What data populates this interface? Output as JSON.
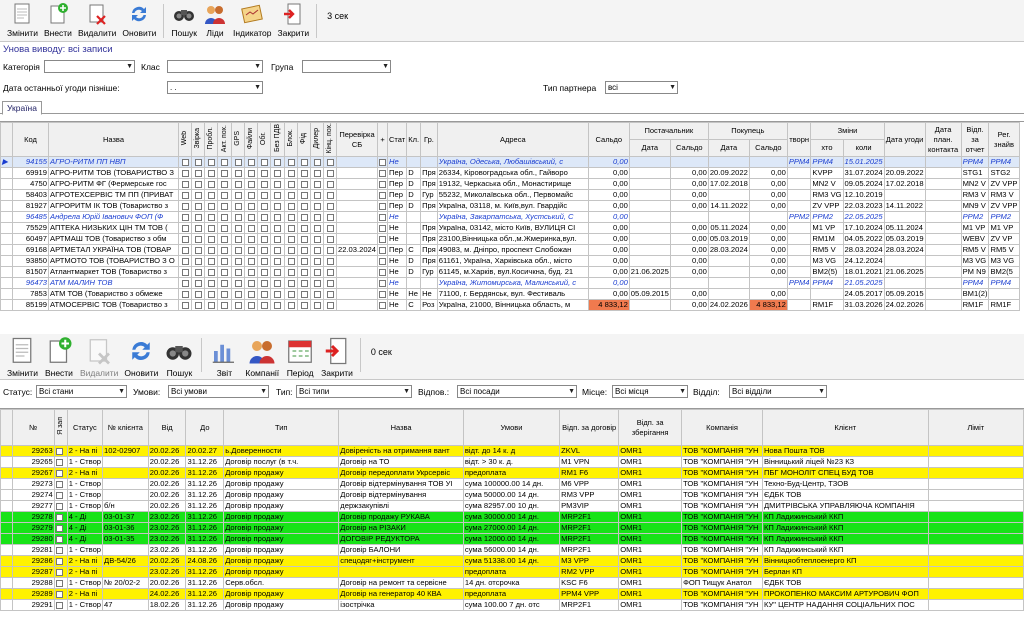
{
  "toolbar1": {
    "buttons": [
      {
        "label": "Змінити",
        "icon": "document-edit-icon"
      },
      {
        "label": "Внести",
        "icon": "document-add-icon"
      },
      {
        "label": "Видалити",
        "icon": "document-delete-icon"
      },
      {
        "label": "Оновити",
        "icon": "refresh-icon"
      },
      {
        "label": "Пошук",
        "icon": "binoculars-icon"
      },
      {
        "label": "Ліди",
        "icon": "people-icon"
      },
      {
        "label": "Індикатор",
        "icon": "indicator-icon"
      },
      {
        "label": "Закрити",
        "icon": "exit-door-icon"
      }
    ],
    "timer": "3 сек"
  },
  "title": "Унова виводу: всі записи",
  "filters1": {
    "category_label": "Категорія",
    "class_label": "Клас",
    "group_label": "Група",
    "date_label": "Дата останньої угоди пізніше:",
    "date_value": ". .",
    "partner_type_label": "Тип партнера",
    "partner_type_value": "всі"
  },
  "tab": "Україна",
  "grid1": {
    "headers": {
      "code": "Код",
      "name": "Назва",
      "web": "Web",
      "paid": "Звірка",
      "prob": "Пробл.",
      "akt": "Акт. пох.",
      "gps": "GPS",
      "files": "Файли",
      "obg": "Обг.",
      "bez": "Без ПДВ",
      "blk": "Блок.",
      "fid": "Фід",
      "dil": "Дилер",
      "kinc": "Кінц. пох.",
      "perev": "Перевірка СБ",
      "plus": "+",
      "stat": "Стат",
      "kl": "Кл.",
      "gr": "Гр.",
      "addr": "Адреса",
      "saldo": "Сальдо",
      "supplier": "Постачальник",
      "buyer": "Покупець",
      "date": "Дата",
      "sald": "Сальдо",
      "creat": "творн",
      "changes": "Зміни",
      "who": "хто",
      "when": "коли",
      "deal_date": "Дата угоди",
      "plan_date": "Дата план. контакта",
      "sent": "Відп. за отчет",
      "reg": "Рег. знайв"
    },
    "rows": [
      {
        "code": "94155",
        "name": "АГРО-РИТМ ПП НВП",
        "perev": "",
        "stat": "Не",
        "kl": "",
        "gr": "",
        "addr": "Україна, Одеська, Любашівський, с",
        "saldo": "0,00",
        "sd": "",
        "ss": "",
        "bd": "",
        "bs": "",
        "creat": "РРМ4",
        "who": "РРМ4",
        "when": "15.01.2025",
        "deal": "",
        "plan": "",
        "sent": "РРМ4",
        "reg": "РРМ4",
        "style": "blue sel"
      },
      {
        "code": "69919",
        "name": "АГРО-РИТМ ТОВ (ТОВАРИСТВО З",
        "perev": "",
        "stat": "Пер",
        "kl": "D",
        "gr": "Пря",
        "addr": "26334, Кіровоградська обл., Гайворо",
        "saldo": "0,00",
        "sd": "",
        "ss": "0,00",
        "bd": "20.09.2022",
        "bs": "0,00",
        "creat": "",
        "who": "KVPP",
        "when": "31.07.2024",
        "deal": "20.09.2022",
        "plan": "",
        "sent": "STG1",
        "reg": "STG2",
        "style": ""
      },
      {
        "code": "4750",
        "name": "АГРО-РИТМ ФГ (Фермерське гос",
        "perev": "",
        "stat": "Пер",
        "kl": "D",
        "gr": "Пря",
        "addr": "19132, Черкаська обл., Монастирище",
        "saldo": "0,00",
        "sd": "",
        "ss": "0,00",
        "bd": "17.02.2018",
        "bs": "0,00",
        "creat": "",
        "who": "MN2 V",
        "when": "09.05.2024",
        "deal": "17.02.2018",
        "plan": "",
        "sent": "MN2 V",
        "reg": "ZV VPP",
        "style": ""
      },
      {
        "code": "58403",
        "name": "АГРОТЕХСЕРВІС ТМ ПП (ПРИВАТ",
        "perev": "",
        "stat": "Пер",
        "kl": "D",
        "gr": "Гур",
        "addr": "55232, Миколаївська обл., Первомайс",
        "saldo": "0,00",
        "sd": "",
        "ss": "0,00",
        "bd": "",
        "bs": "0,00",
        "creat": "",
        "who": "RM3 VG",
        "when": "12.10.2019",
        "deal": "",
        "plan": "",
        "sent": "RM3 V",
        "reg": "RM3 V",
        "style": ""
      },
      {
        "code": "81927",
        "name": "АГРОРИТМ ІК ТОВ (Товариство з",
        "perev": "",
        "stat": "Пер",
        "kl": "D",
        "gr": "Пря",
        "addr": "Україна, 03118, м. Київ,вул. Гвардійс",
        "saldo": "0,00",
        "sd": "",
        "ss": "0,00",
        "bd": "14.11.2022",
        "bs": "0,00",
        "creat": "",
        "who": "ZV VPP",
        "when": "22.03.2023",
        "deal": "14.11.2022",
        "plan": "",
        "sent": "MN9 V",
        "reg": "ZV VPP",
        "style": ""
      },
      {
        "code": "96485",
        "name": "Андрела Юрій Іванович ФОП (Ф",
        "perev": "",
        "stat": "Не",
        "kl": "",
        "gr": "",
        "addr": "Україна, Закарпатська, Хустський, С",
        "saldo": "0,00",
        "sd": "",
        "ss": "",
        "bd": "",
        "bs": "",
        "creat": "РРМ2",
        "who": "РРМ2",
        "when": "22.05.2025",
        "deal": "",
        "plan": "",
        "sent": "РРМ2",
        "reg": "РРМ2",
        "style": "blue"
      },
      {
        "code": "75529",
        "name": "АПТЕКА НИЗЬКИХ ЦІН ТМ ТОВ (",
        "perev": "",
        "stat": "Не",
        "kl": "",
        "gr": "Пря",
        "addr": "Україна, 03142, місто Київ, ВУЛИЦЯ СІ",
        "saldo": "0,00",
        "sd": "",
        "ss": "0,00",
        "bd": "05.11.2024",
        "bs": "0,00",
        "creat": "",
        "who": "M1 VP",
        "when": "17.10.2024",
        "deal": "05.11.2024",
        "plan": "",
        "sent": "M1 VP",
        "reg": "M1 VP",
        "style": ""
      },
      {
        "code": "60497",
        "name": "АРТМАШ ТОВ (Товариство з обм",
        "perev": "",
        "stat": "Не",
        "kl": "",
        "gr": "Пря",
        "addr": "23100,Вінницька обл.,м.Жмеринка,вул.",
        "saldo": "0,00",
        "sd": "",
        "ss": "0,00",
        "bd": "05.03.2019",
        "bs": "0,00",
        "creat": "",
        "who": "RM1M",
        "when": "04.05.2022",
        "deal": "05.03.2019",
        "plan": "",
        "sent": "WEBV",
        "reg": "ZV VP",
        "style": ""
      },
      {
        "code": "69168",
        "name": "АРТМЕТАЛ УКРАЇНА ТОВ (ТОВАР",
        "perev": "22.03.2024",
        "stat": "Пер",
        "kl": "С",
        "gr": "Пря",
        "addr": "49083, м. Дніпро, проспект Слобожан",
        "saldo": "0,00",
        "sd": "",
        "ss": "0,00",
        "bd": "28.03.2024",
        "bs": "0,00",
        "creat": "",
        "who": "RM5 V",
        "when": "28.03.2024",
        "deal": "28.03.2024",
        "plan": "",
        "sent": "RM5 V",
        "reg": "RM5 V",
        "style": ""
      },
      {
        "code": "93850",
        "name": "АРТМОТО ТОВ (ТОВАРИСТВО З О",
        "perev": "",
        "stat": "Не",
        "kl": "D",
        "gr": "Пря",
        "addr": "61161, Україна, Харківська обл., місто",
        "saldo": "0,00",
        "sd": "",
        "ss": "0,00",
        "bd": "",
        "bs": "0,00",
        "creat": "",
        "who": "M3 VG",
        "when": "24.12.2024",
        "deal": "",
        "plan": "",
        "sent": "M3 VG",
        "reg": "M3 VG",
        "style": ""
      },
      {
        "code": "81507",
        "name": "Атлантмаркет ТОВ (Товариство з",
        "perev": "",
        "stat": "Не",
        "kl": "D",
        "gr": "Гур",
        "addr": "61145, м.Харків, вул.Косичкна, буд. 21",
        "saldo": "0,00",
        "sd": "21.06.2025",
        "ss": "0,00",
        "bd": "",
        "bs": "0,00",
        "creat": "",
        "who": "BM2(5)",
        "when": "18.01.2021",
        "deal": "21.06.2025",
        "plan": "",
        "sent": "PM N9",
        "reg": "BM2(5",
        "style": ""
      },
      {
        "code": "96473",
        "name": "АТМ МАЛИН ТОВ",
        "perev": "",
        "stat": "Не",
        "kl": "",
        "gr": "",
        "addr": "Україна, Житомирська, Малинський, с",
        "saldo": "0,00",
        "sd": "",
        "ss": "",
        "bd": "",
        "bs": "",
        "creat": "РРМ4",
        "who": "РРМ4",
        "when": "21.05.2025",
        "deal": "",
        "plan": "",
        "sent": "РРМ4",
        "reg": "РРМ4",
        "style": "blue"
      },
      {
        "code": "7853",
        "name": "АТМ ТОВ (Товариство з обмеже",
        "perev": "",
        "stat": "Не",
        "kl": "Не",
        "gr": "Не",
        "addr": "71100, г. Бердянськ, вул. Фестиваль",
        "saldo": "0,00",
        "sd": "05.09.2015",
        "ss": "0,00",
        "bd": "",
        "bs": "0,00",
        "creat": "",
        "who": "",
        "when": "24.05.2017",
        "deal": "05.09.2015",
        "plan": "",
        "sent": "BM1(2)",
        "reg": "",
        "style": ""
      },
      {
        "code": "85199",
        "name": "АТМОСЕРВІС ТОВ (Товариство з",
        "perev": "",
        "stat": "Не",
        "kl": "С",
        "gr": "Роз",
        "addr": "Україна, 21000, Вінницька область, м",
        "saldo": "4 833,12",
        "sd": "",
        "ss": "0,00",
        "bd": "24.02.2026",
        "bs": "4 833,12",
        "creat": "",
        "who": "RM1F",
        "when": "31.03.2026",
        "deal": "24.02.2026",
        "plan": "",
        "sent": "RM1F",
        "reg": "RM1F",
        "style": "",
        "red": true
      }
    ]
  },
  "toolbar2": {
    "buttons": [
      {
        "label": "Змінити",
        "icon": "document-edit-icon"
      },
      {
        "label": "Внести",
        "icon": "document-add-icon"
      },
      {
        "label": "Видалити",
        "icon": "document-delete-icon"
      },
      {
        "label": "Оновити",
        "icon": "refresh-icon"
      },
      {
        "label": "Пошук",
        "icon": "binoculars-icon"
      },
      {
        "label": "Звіт",
        "icon": "report-chart-icon"
      },
      {
        "label": "Компанії",
        "icon": "people-icon"
      },
      {
        "label": "Період",
        "icon": "calendar-icon"
      },
      {
        "label": "Закрити",
        "icon": "exit-door-icon"
      }
    ],
    "timer": "0 сек"
  },
  "filters2": {
    "status_label": "Статус:",
    "status_value": "Всі стани",
    "terms_label": "Умови:",
    "terms_value": "Всі умови",
    "type_label": "Тип:",
    "type_value": "Всі типи",
    "resp_label": "Відпов.:",
    "resp_value": "Всі посади",
    "place_label": "Місце:",
    "place_value": "Всі місця",
    "dept_label": "Відділ:",
    "dept_value": "Всі відділи"
  },
  "grid2": {
    "headers": {
      "num": "№",
      "status": "Статус",
      "client_num": "№ клієнта",
      "from": "Від",
      "to": "До",
      "type": "Тип",
      "name": "Назва",
      "terms": "Умови",
      "resp_contract": "Відп. за договір",
      "resp_storage": "Відп. за зберігання",
      "company": "Компанія",
      "client": "Клієнт",
      "limit": "Ліміт",
      "flag": "Я зап"
    },
    "rows": [
      {
        "num": "29263",
        "status": "2 - На пі",
        "cn": "102-02907",
        "from": "20.02.26",
        "to": "20.02.27",
        "type": "ь.Доверенности",
        "name": "Довіреність на отримання вант",
        "terms": "відт. до 14 к. д",
        "rc": "ZKVL",
        "rs": "OMR1",
        "company": "ТОВ \"КОМПАНІЯ \"УН",
        "client": "Нова Пошта ТОВ",
        "style": "yel"
      },
      {
        "num": "29265",
        "status": "1 - Створ",
        "cn": "",
        "from": "20.02.26",
        "to": "31.12.26",
        "type": "Договір послуг (в т.ч.",
        "name": "Договір на ТО",
        "terms": "відт. > 30 к. д.",
        "rc": "M1 VPN",
        "rs": "OMR1",
        "company": "ТОВ \"КОМПАНІЯ \"УН",
        "client": "Вінницький ліцей №23 КЗ",
        "style": "wht"
      },
      {
        "num": "29267",
        "status": "2 - На пі",
        "cn": "",
        "from": "20.02.26",
        "to": "31.12.26",
        "type": "Договір продажу",
        "name": "Договір передоплати Укрсервіс",
        "terms": "предоплата",
        "rc": "RM1 F6",
        "rs": "OMR1",
        "company": "ТОВ \"КОМПАНІЯ \"УН",
        "client": "ПБГ МОНОЛІТ СПЕЦ БУД ТОВ",
        "style": "yel"
      },
      {
        "num": "29273",
        "status": "1 - Створ",
        "cn": "",
        "from": "20.02.26",
        "to": "31.12.26",
        "type": "Договір продажу",
        "name": "Договір відтермінування ТОВ УІ",
        "terms": "сума 100000.00 14 дн.",
        "rc": "M6 VPP",
        "rs": "OMR1",
        "company": "ТОВ \"КОМПАНІЯ \"УН",
        "client": "Техно-Буд-Центр, ТЗОВ",
        "style": "wht"
      },
      {
        "num": "29274",
        "status": "1 - Створ",
        "cn": "",
        "from": "20.02.26",
        "to": "31.12.26",
        "type": "Договір продажу",
        "name": "Договір відтермінування",
        "terms": "сума 50000.00 14 дн.",
        "rc": "RM3 VPP",
        "rs": "OMR1",
        "company": "ТОВ \"КОМПАНІЯ \"УН",
        "client": "ЄДБК ТОВ",
        "style": "wht"
      },
      {
        "num": "29277",
        "status": "1 - Створ",
        "cn": "б/н",
        "from": "20.02.26",
        "to": "31.12.26",
        "type": "Договір продажу",
        "name": "держзакупівлі",
        "terms": "сума 82957.00 10 дн.",
        "rc": "PM3VIP",
        "rs": "OMR1",
        "company": "ТОВ \"КОМПАНІЯ \"УН",
        "client": "ДМИТРІВСЬКА УПРАВЛЯЮЧА КОМПАНІЯ",
        "style": "wht"
      },
      {
        "num": "29278",
        "status": "4 - Ді",
        "cn": "03-01-37",
        "from": "23.02.26",
        "to": "31.12.26",
        "type": "Договір продажу",
        "name": "Договір продажу РУКАВА",
        "terms": "сума 30000.00 14 дн.",
        "rc": "MRP2F1",
        "rs": "OMR1",
        "company": "ТОВ \"КОМПАНІЯ \"УН",
        "client": "КП Ладижинський ККП",
        "style": "grn"
      },
      {
        "num": "29279",
        "status": "4 - Ді",
        "cn": "03-01-36",
        "from": "23.02.26",
        "to": "31.12.26",
        "type": "Договір продажу",
        "name": "Договір на РІЗАКИ",
        "terms": "сума 27000.00 14 дн.",
        "rc": "MRP2F1",
        "rs": "OMR1",
        "company": "ТОВ \"КОМПАНІЯ \"УН",
        "client": "КП Ладижинський ККП",
        "style": "grn"
      },
      {
        "num": "29280",
        "status": "4 - Ді",
        "cn": "03-01-35",
        "from": "23.02.26",
        "to": "31.12.26",
        "type": "Договір продажу",
        "name": "ДОГОВІР РЕДУКТОРА",
        "terms": "сума 12000.00 14 дн.",
        "rc": "MRP2F1",
        "rs": "OMR1",
        "company": "ТОВ \"КОМПАНІЯ \"УН",
        "client": "КП Ладижинський ККП",
        "style": "grn"
      },
      {
        "num": "29281",
        "status": "1 - Створ",
        "cn": "",
        "from": "23.02.26",
        "to": "31.12.26",
        "type": "Договір продажу",
        "name": "Договір БАЛОНИ",
        "terms": "сума 56000.00 14 дн.",
        "rc": "MRP2F1",
        "rs": "OMR1",
        "company": "ТОВ \"КОМПАНІЯ \"УН",
        "client": "КП Ладижинський ККП",
        "style": "wht"
      },
      {
        "num": "29286",
        "status": "2 - На пі",
        "cn": "ДВ-54/26",
        "from": "20.02.26",
        "to": "24.08.26",
        "type": "Договір продажу",
        "name": "спецодяг+інструмент",
        "terms": "сума 51338.00 14 дн.",
        "rc": "M3 VPP",
        "rs": "OMR1",
        "company": "ТОВ \"КОМПАНІЯ \"УН",
        "client": "Вінницяобтеплоенерго КП",
        "style": "yel"
      },
      {
        "num": "29287",
        "status": "2 - На пі",
        "cn": "",
        "from": "23.02.26",
        "to": "31.12.26",
        "type": "Договір продажу",
        "name": "",
        "terms": "предоплата",
        "rc": "RM2 VPP",
        "rs": "OMR1",
        "company": "ТОВ \"КОМПАНІЯ \"УН",
        "client": "Берлан КП",
        "style": "yel"
      },
      {
        "num": "29288",
        "status": "1 - Створ",
        "cn": "№ 20/02-2",
        "from": "20.02.26",
        "to": "31.12.26",
        "type": "Серв.обсл.",
        "name": "Договір на ремонт та сервісне",
        "terms": "14 дн. отсрочка",
        "rc": "KSC F6",
        "rs": "OMR1",
        "company": "ФОП Тищук Анатол",
        "client": "ЄДБК ТОВ",
        "style": "wht"
      },
      {
        "num": "29289",
        "status": "2 - На пі",
        "cn": "",
        "from": "24.02.26",
        "to": "31.12.26",
        "type": "Договір продажу",
        "name": "Договір на генератор 40 КВА",
        "terms": "предоплата",
        "rc": "PPM4 VPP",
        "rs": "OMR1",
        "company": "ТОВ \"КОМПАНІЯ \"УН",
        "client": "ПРОКОПЕНКО МАКСИМ АРТУРОВИЧ ФОП",
        "style": "yel"
      },
      {
        "num": "29291",
        "status": "1 - Створ",
        "cn": "47",
        "from": "18.02.26",
        "to": "31.12.26",
        "type": "Договір продажу",
        "name": "ізострічка",
        "terms": "сума 100.00 7 дн. отс",
        "rc": "MRP2F1",
        "rs": "OMR1",
        "company": "ТОВ \"КОМПАНІЯ \"УН",
        "client": "КУ\" ЦЕНТР НАДАННЯ СОЦІАЛЬНИХ ПОС",
        "style": "wht"
      }
    ]
  },
  "colors": {
    "yellow": "#fff200",
    "green": "#18e318",
    "blue_text": "#1a3dd0",
    "red_cell": "#f07a4e"
  }
}
